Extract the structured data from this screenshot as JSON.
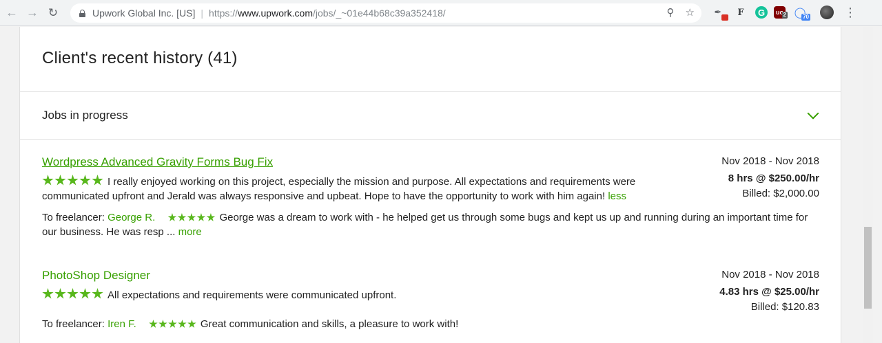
{
  "browser": {
    "site_name": "Upwork Global Inc. [US]",
    "url_scheme": "https://",
    "url_host": "www.upwork.com",
    "url_path": "/jobs/_~01e44b68c39a352418/",
    "extensions": [
      {
        "icon": "dropper-icon",
        "badge": ""
      },
      {
        "icon": "font-icon",
        "badge": ""
      },
      {
        "icon": "grammarly-icon",
        "badge": ""
      },
      {
        "icon": "ublock-icon",
        "badge": "2"
      },
      {
        "icon": "translate-icon",
        "badge": "70"
      }
    ]
  },
  "history": {
    "title": "Client's recent history (41)",
    "section_label": "Jobs in progress"
  },
  "jobs": [
    {
      "title": "Wordpress Advanced Gravity Forms Bug Fix",
      "date_range": "Nov 2018 - Nov 2018",
      "rate": "8 hrs @ $250.00/hr",
      "billed": "Billed: $2,000.00",
      "client_rating": 5,
      "client_feedback": "I really enjoyed working on this project, especially the mission and purpose. All expectations and requirements were communicated upfront and Jerald was always responsive and upbeat. Hope to have the opportunity to work with him again!",
      "toggle_label": "less",
      "freelancer_prefix": "To freelancer:",
      "freelancer_name": "George R.",
      "freelancer_rating": 5,
      "freelancer_feedback": "George was a dream to work with - he helped get us through some bugs and kept us up and running during an important time for our business. He was resp ...",
      "more_label": "more"
    },
    {
      "title": "PhotoShop Designer",
      "date_range": "Nov 2018 - Nov 2018",
      "rate": "4.83 hrs @ $25.00/hr",
      "billed": "Billed: $120.83",
      "client_rating": 5,
      "client_feedback": "All expectations and requirements were communicated upfront.",
      "freelancer_prefix": "To freelancer:",
      "freelancer_name": "Iren F.",
      "freelancer_rating": 5,
      "freelancer_feedback": "Great communication and skills, a pleasure to work with!"
    }
  ],
  "colors": {
    "upwork_green": "#37a000",
    "star_green": "#58b71c"
  }
}
